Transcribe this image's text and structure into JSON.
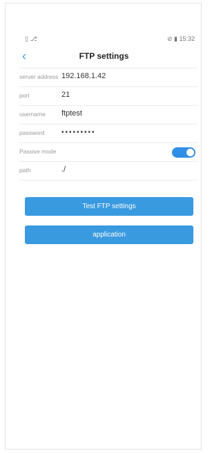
{
  "status_bar": {
    "left_icons": "▯ ⎇",
    "right_icons": "⊘ ▮",
    "time": "15:32"
  },
  "nav": {
    "title": "FTP settings",
    "back_icon": "‹"
  },
  "fields": [
    {
      "label": "server address",
      "value": "192.168.1.42"
    },
    {
      "label": "port",
      "value": "21"
    },
    {
      "label": "username",
      "value": "ftptest"
    },
    {
      "label": "password",
      "value": "•••••••••"
    },
    {
      "label": "Passive mode",
      "toggle_on": true
    },
    {
      "label": "path",
      "value": "./"
    }
  ],
  "buttons": {
    "test_label": "Test FTP settings",
    "apply_label": "application"
  },
  "colors": {
    "accent": "#3d9ee8",
    "button": "#3a9ae0",
    "toggle": "#2f8ee6"
  }
}
